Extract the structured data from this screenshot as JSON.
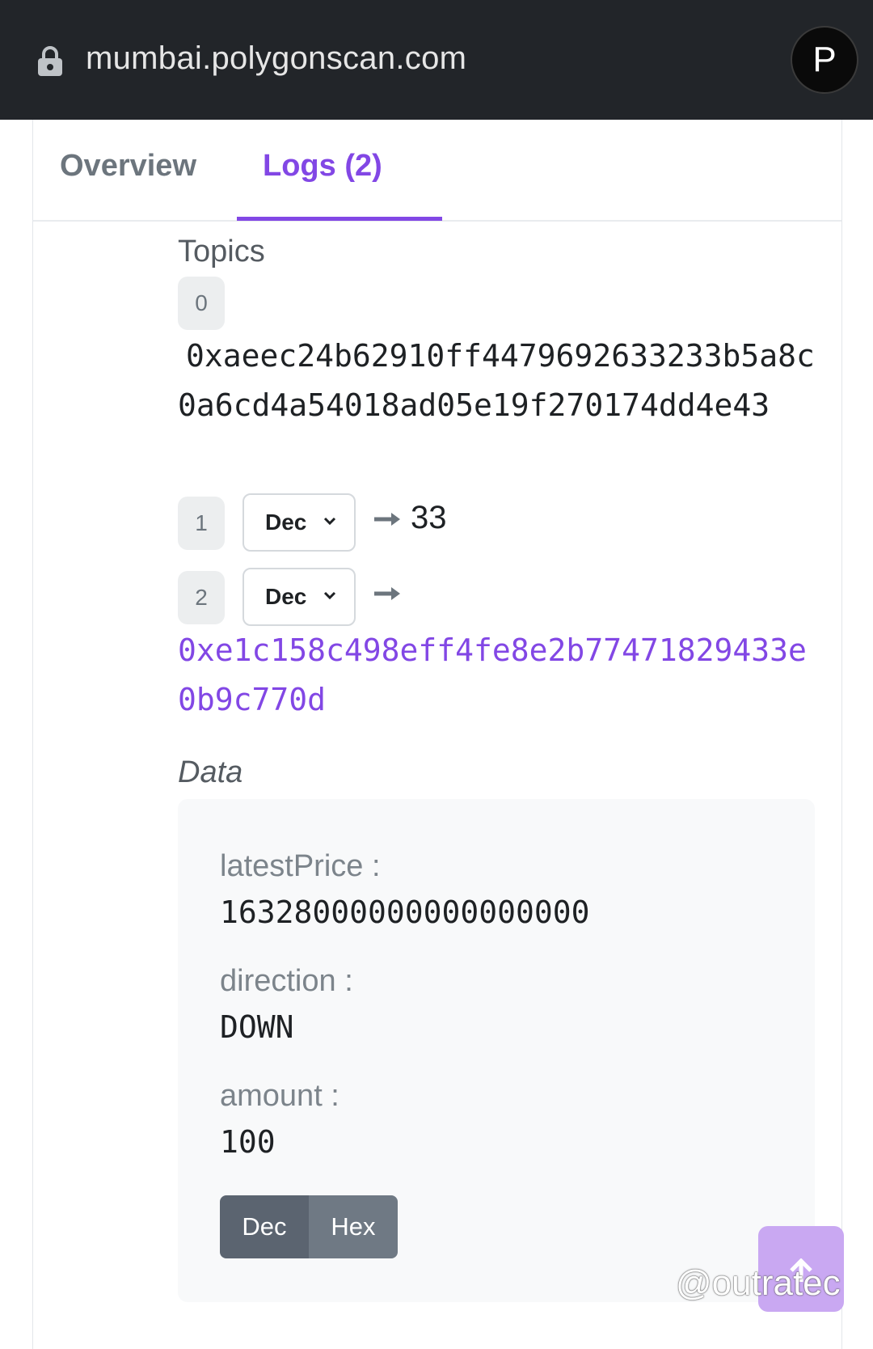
{
  "browser": {
    "url": "mumbai.polygonscan.com",
    "avatar_letter": "P"
  },
  "tabs": [
    {
      "label": "Overview",
      "active": false
    },
    {
      "label": "Logs (2)",
      "active": true
    }
  ],
  "topics": {
    "label": "Topics",
    "items": [
      {
        "index": "0",
        "value": "0xaeec24b62910ff4479692633233b5a8c0a6cd4a54018ad05e19f270174dd4e43"
      },
      {
        "index": "1",
        "format": "Dec",
        "value": "33"
      },
      {
        "index": "2",
        "format": "Dec",
        "value": "0xe1c158c498eff4fe8e2b77471829433e0b9c770d"
      }
    ]
  },
  "data": {
    "label": "Data",
    "fields": [
      {
        "name": "latestPrice :",
        "value": "16328000000000000000"
      },
      {
        "name": "direction :",
        "value": "DOWN"
      },
      {
        "name": "amount :",
        "value": "100"
      }
    ],
    "toggle": {
      "dec_label": "Dec",
      "hex_label": "Hex",
      "selected": "Dec"
    }
  },
  "watermark": "@outratec",
  "colors": {
    "accent": "#8247e5",
    "topbar": "#222529"
  },
  "icons": [
    "lock-icon",
    "chevron-down-icon",
    "arrow-right-icon",
    "arrow-up-icon"
  ]
}
